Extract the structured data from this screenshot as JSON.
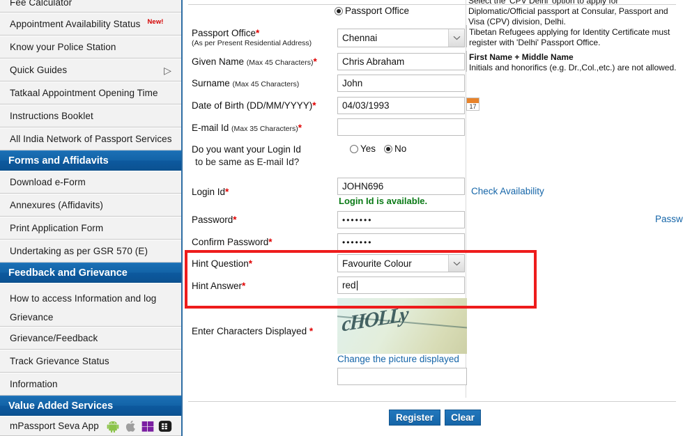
{
  "sidebar": {
    "items": [
      {
        "label": "Fee Calculator",
        "type": "link",
        "clipped_top": true
      },
      {
        "label": "Appointment Availability Status",
        "type": "link",
        "badge": "New!"
      },
      {
        "label": "Know your Police Station",
        "type": "link"
      },
      {
        "label": "Quick Guides",
        "type": "link",
        "chevron": "▷"
      },
      {
        "label": "Tatkaal Appointment Opening Time",
        "type": "link"
      },
      {
        "label": "Instructions Booklet",
        "type": "link"
      },
      {
        "label": "All India Network of Passport Services",
        "type": "link"
      },
      {
        "label": "Forms and Affidavits",
        "type": "header"
      },
      {
        "label": "Download e-Form",
        "type": "link"
      },
      {
        "label": "Annexures (Affidavits)",
        "type": "link"
      },
      {
        "label": "Print Application Form",
        "type": "link"
      },
      {
        "label": "Undertaking as per GSR 570 (E)",
        "type": "link"
      },
      {
        "label": "Feedback and Grievance",
        "type": "header"
      },
      {
        "label": "How to access Information and log Grievance",
        "type": "link",
        "two_line": true
      },
      {
        "label": "Grievance/Feedback",
        "type": "link"
      },
      {
        "label": "Track Grievance Status",
        "type": "link"
      },
      {
        "label": "Information",
        "type": "link"
      },
      {
        "label": "Value Added Services",
        "type": "header"
      },
      {
        "label": "mPassport Seva App",
        "type": "link",
        "os_icons": [
          "android-icon",
          "apple-icon",
          "windows-icon",
          "blackberry-icon"
        ]
      }
    ],
    "colors": {
      "header_blue": "#0d599e",
      "badge_red": "#d40000",
      "row_bg": "#f2f2f2"
    }
  },
  "form": {
    "office_type_radio": {
      "label": "Passport Office",
      "selected": true
    },
    "passport_office": {
      "label": "Passport Office",
      "required_mark": "*",
      "sublabel": "(As per Present Residential Address)",
      "value": "Chennai"
    },
    "given_name": {
      "label": "Given Name",
      "hint": "(Max 45 Characters)",
      "required_mark": "*",
      "value": "Chris Abraham"
    },
    "surname": {
      "label": "Surname",
      "hint": "(Max 45 Characters)",
      "required_mark": "",
      "value": "John"
    },
    "dob": {
      "label": "Date of Birth (DD/MM/YYYY)",
      "required_mark": "*",
      "value": "04/03/1993",
      "calendar_icon_day": "17"
    },
    "email": {
      "label": "E-mail Id",
      "hint": "(Max 35 Characters)",
      "required_mark": "*",
      "value": ""
    },
    "login_same_as_email": {
      "label_line1": "Do you want your Login Id",
      "label_line2": "to be same as E-mail Id?",
      "options": [
        "Yes",
        "No"
      ],
      "selected": "No"
    },
    "login_id": {
      "label": "Login Id",
      "required_mark": "*",
      "value": "JOHN696",
      "check_link": "Check Availability",
      "status_message": "Login Id is available."
    },
    "password": {
      "label": "Password",
      "required_mark": "*",
      "value": "•••••••",
      "policy_link": "Password Policy"
    },
    "confirm_password": {
      "label": "Confirm Password",
      "required_mark": "*",
      "value": "•••••••"
    },
    "hint_question": {
      "label": "Hint Question",
      "required_mark": "*",
      "value": "Favourite Colour"
    },
    "hint_answer": {
      "label": "Hint Answer",
      "required_mark": "*",
      "value": "red"
    },
    "captcha": {
      "label": "Enter Characters Displayed",
      "required_mark": "*",
      "image_text": "cHOLLy",
      "refresh_link": "Change the picture displayed",
      "value": ""
    },
    "buttons": {
      "register": "Register",
      "clear": "Clear"
    }
  },
  "help": {
    "note_cpv": "Select the 'CPV Delhi' option to apply for Diplomatic/Official passport at Consular, Passport and Visa (CPV) division, Delhi.",
    "note_tibetan": "Tibetan Refugees applying for Identity Certificate must register with 'Delhi' Passport Office.",
    "name_title": "First Name + Middle Name",
    "name_body": "Initials and honorifics (e.g. Dr.,Col.,etc.) are not allowed."
  },
  "annotation": {
    "highlight_color": "#ee1c1c",
    "highlight_target": "hint-question-and-answer-fields"
  }
}
